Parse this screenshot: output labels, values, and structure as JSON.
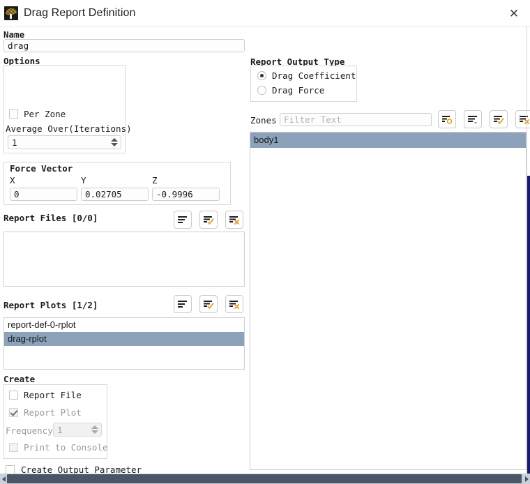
{
  "window": {
    "title": "Drag Report Definition",
    "icon": "fluent-app-icon",
    "close_label": "✕"
  },
  "name_section": {
    "label": "Name",
    "value": "drag"
  },
  "options": {
    "label": "Options",
    "per_zone": {
      "label": "Per Zone",
      "checked": false
    },
    "average_over": {
      "label": "Average Over(Iterations)",
      "value": "1"
    }
  },
  "force_vector": {
    "label": "Force Vector",
    "fields": [
      {
        "label": "X",
        "value": "0"
      },
      {
        "label": "Y",
        "value": "0.02705"
      },
      {
        "label": "Z",
        "value": "-0.9996"
      }
    ]
  },
  "report_files": {
    "label": "Report Files [0/0]",
    "items": [],
    "toolbar": [
      {
        "name": "list-icon",
        "title": "List"
      },
      {
        "name": "list-check-icon",
        "title": "Select All"
      },
      {
        "name": "list-x-icon",
        "title": "Deselect All"
      }
    ]
  },
  "report_plots": {
    "label": "Report Plots [1/2]",
    "items": [
      {
        "text": "report-def-0-rplot",
        "selected": false
      },
      {
        "text": "drag-rplot",
        "selected": true
      }
    ],
    "toolbar": [
      {
        "name": "list-icon",
        "title": "List"
      },
      {
        "name": "list-check-icon",
        "title": "Select All"
      },
      {
        "name": "list-x-icon",
        "title": "Deselect All"
      }
    ]
  },
  "create": {
    "label": "Create",
    "report_file": {
      "label": "Report File",
      "checked": false,
      "disabled": false
    },
    "report_plot": {
      "label": "Report Plot",
      "checked": true,
      "disabled": true
    },
    "frequency": {
      "label": "Frequency",
      "value": "1",
      "disabled": true
    },
    "print_to_console": {
      "label": "Print to Console",
      "checked": false,
      "disabled": true
    }
  },
  "create_output_parameter": {
    "label": "Create Output Parameter",
    "checked": false
  },
  "report_output_type": {
    "label": "Report Output Type",
    "options": [
      {
        "label": "Drag Coefficient",
        "selected": true
      },
      {
        "label": "Drag Force",
        "selected": false
      }
    ]
  },
  "zones": {
    "label": "Zones",
    "filter_placeholder": "Filter Text",
    "filter_value": "",
    "items": [
      {
        "text": "body1",
        "selected": true
      }
    ],
    "toolbar": [
      {
        "name": "list-target-icon",
        "title": "Use Selected"
      },
      {
        "name": "list-dropdown-icon",
        "title": "Filter Options"
      },
      {
        "name": "list-check-icon",
        "title": "Select All"
      },
      {
        "name": "list-x-icon",
        "title": "Deselect All"
      }
    ]
  },
  "scrollbars": {
    "horizontal": {
      "left_arrow": "◀",
      "right_arrow": "▶"
    }
  },
  "colors": {
    "selection": "#8ca2ba",
    "accent_orange": "#e8a33d",
    "scroll_thumb": "#4a5568",
    "scroll_track": "#c9d0da"
  }
}
